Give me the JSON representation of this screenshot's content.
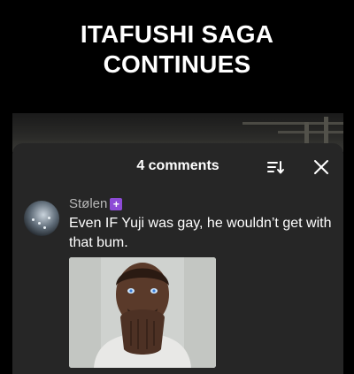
{
  "caption": {
    "line1": "ITAFUSHI SAGA",
    "line2": "CONTINUES"
  },
  "comments_sheet": {
    "title": "4 comments",
    "sort_icon": "sort-icon",
    "close_icon": "close-icon"
  },
  "comment": {
    "username": "Stølen",
    "badge_icon": "plus-badge-icon",
    "badge_glyph": "+",
    "text": "Even IF Yuji was gay, he wouldn’t get with that bum.",
    "avatar_icon": "avatar",
    "attachment_icon": "praying-hands-man-image"
  },
  "colors": {
    "background": "#000000",
    "sheet": "#262626",
    "badge": "#8d4bd6",
    "username": "#b9b9b9"
  }
}
